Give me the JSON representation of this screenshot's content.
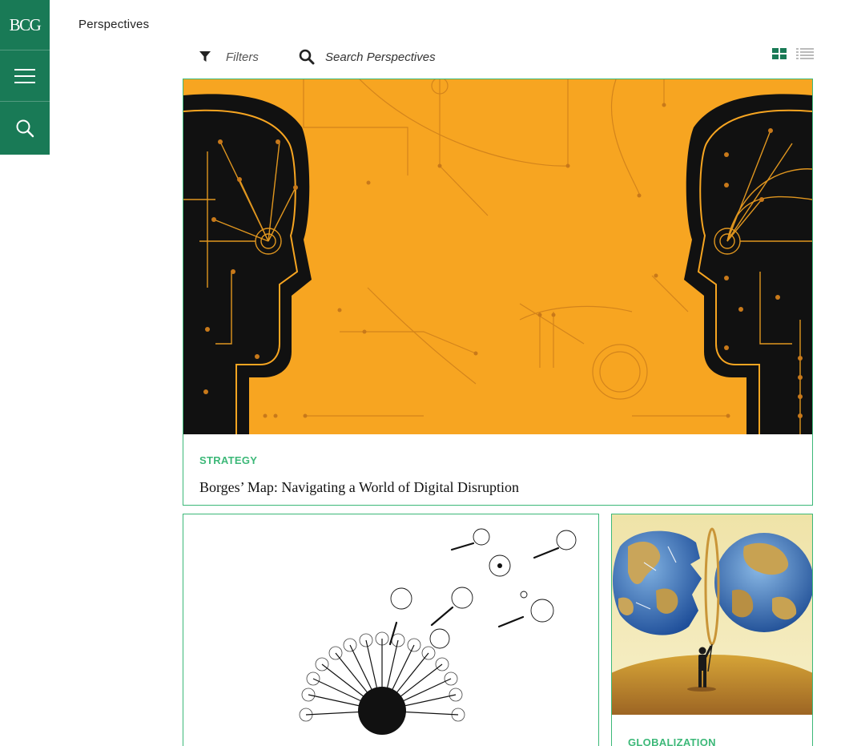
{
  "brand": {
    "logo_text": "BCG",
    "accent": "#197a56",
    "category_color": "#3cb878"
  },
  "section_title": "Perspectives",
  "toolbar": {
    "filters_label": "Filters",
    "search_label": "Search Perspectives",
    "filter_icon": "funnel-icon",
    "search_icon": "magnifier-icon",
    "views": [
      {
        "name": "grid-view-icon",
        "active": true
      },
      {
        "name": "list-view-icon",
        "active": false
      }
    ]
  },
  "rail": {
    "items": [
      {
        "name": "bcg-logo"
      },
      {
        "name": "menu-icon"
      },
      {
        "name": "search-icon"
      }
    ]
  },
  "cards": [
    {
      "category": "STRATEGY",
      "title": "Borges’ Map: Navigating a World of Digital Disruption",
      "image": "two-circuit-heads-illustration",
      "background": "#f7a521"
    },
    {
      "category": "",
      "title": "",
      "image": "dandelion-seeds-illustration"
    },
    {
      "category": "GLOBALIZATION",
      "title": "",
      "image": "globe-puzzle-illustration"
    }
  ]
}
